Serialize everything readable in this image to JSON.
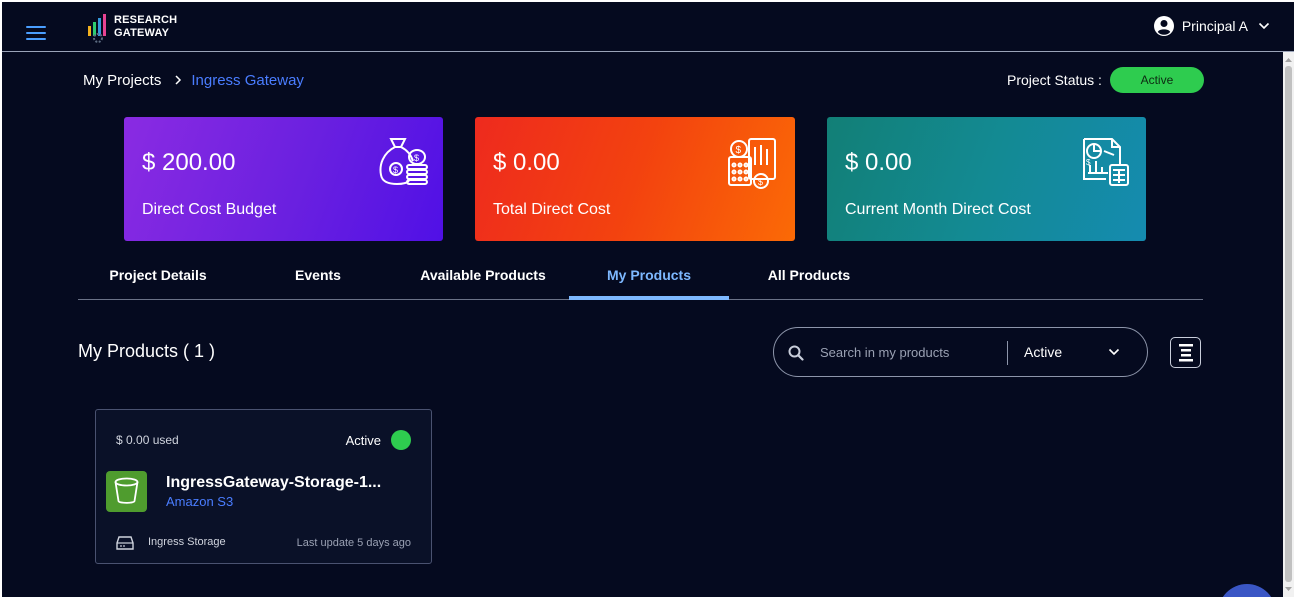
{
  "header": {
    "logo_line1": "RESEARCH",
    "logo_line2": "GATEWAY",
    "user_name": "Principal A"
  },
  "breadcrumb": {
    "root": "My Projects",
    "current": "Ingress Gateway"
  },
  "project_status": {
    "label": "Project Status :",
    "value": "Active"
  },
  "cards": [
    {
      "value": "$ 200.00",
      "label": "Direct Cost Budget",
      "icon": "money-bag-icon"
    },
    {
      "value": "$ 0.00",
      "label": "Total Direct Cost",
      "icon": "calculator-coins-icon"
    },
    {
      "value": "$ 0.00",
      "label": "Current Month Direct Cost",
      "icon": "report-chart-icon"
    }
  ],
  "tabs": [
    {
      "label": "Project Details",
      "active": false
    },
    {
      "label": "Events",
      "active": false
    },
    {
      "label": "Available Products",
      "active": false
    },
    {
      "label": "My Products",
      "active": true
    },
    {
      "label": "All Products",
      "active": false
    }
  ],
  "products": {
    "title": "My Products ( 1 )",
    "search_placeholder": "Search in my products",
    "search_value": "",
    "filter_value": "Active",
    "items": [
      {
        "used": "$ 0.00 used",
        "status": "Active",
        "name": "IngressGateway-Storage-1...",
        "type": "Amazon S3",
        "category": "Ingress Storage",
        "last_update": "Last update 5 days ago"
      }
    ]
  },
  "colors": {
    "background": "#050a1f",
    "accent_blue": "#4a7dff",
    "active_tab": "#7db8ff",
    "status_green": "#2ecc4f"
  }
}
